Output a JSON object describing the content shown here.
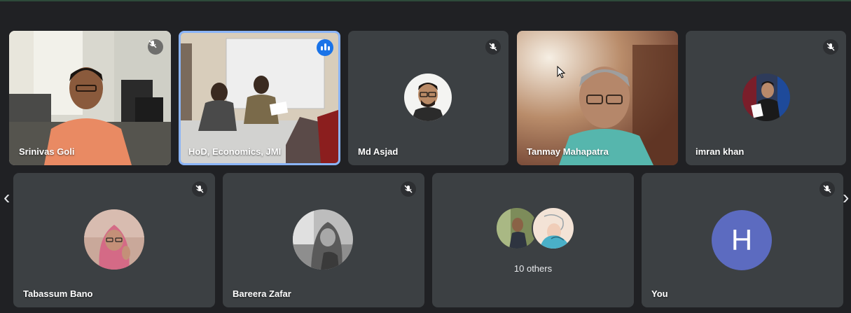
{
  "participants_row1": [
    {
      "name": "Srinivas Goli",
      "mic": "muted",
      "kind": "video"
    },
    {
      "name": "HoD, Economics, JMI",
      "mic": "speaking",
      "kind": "video"
    },
    {
      "name": "Md Asjad",
      "mic": "muted",
      "kind": "avatar"
    },
    {
      "name": "Tanmay Mahapatra",
      "mic": "on",
      "kind": "video"
    },
    {
      "name": "imran khan",
      "mic": "muted",
      "kind": "avatar"
    }
  ],
  "participants_row2": [
    {
      "name": "Tabassum Bano",
      "mic": "muted",
      "kind": "avatar"
    },
    {
      "name": "Bareera Zafar",
      "mic": "muted",
      "kind": "avatar"
    },
    {
      "name": "10 others",
      "mic": "none",
      "kind": "group"
    },
    {
      "name": "You",
      "mic": "muted",
      "kind": "letter",
      "initial": "H",
      "avatar_color": "#5c6bc0"
    }
  ],
  "nav": {
    "prev": "‹",
    "next": "›"
  },
  "icons": {
    "mic_off": "mic-off-icon",
    "speaking": "audio-level-icon"
  },
  "colors": {
    "background": "#202124",
    "tile": "#3c4043",
    "speaking_border": "#8ab4f8",
    "speaking_dot": "#1a73e8"
  }
}
